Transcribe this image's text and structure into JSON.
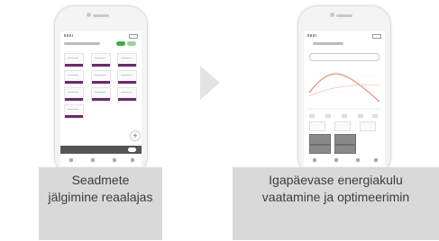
{
  "slides": [
    {
      "caption_lines": [
        "Seadmete",
        "jälgimine reaalajas"
      ],
      "phone_screen": "device-monitoring"
    },
    {
      "caption_lines": [
        "Igapäevase energiakulu",
        "vaatamine ja optimeerimin"
      ],
      "phone_screen": "energy-chart"
    }
  ],
  "navigation": {
    "arrow_icon": "chevron-right-icon"
  },
  "colors": {
    "caption_background": "#d9d9d9",
    "caption_text": "#3c3c3c",
    "accent_purple": "#6b2b6b",
    "toggle_green": "#3fae49",
    "chart_line": "#e0907a"
  }
}
